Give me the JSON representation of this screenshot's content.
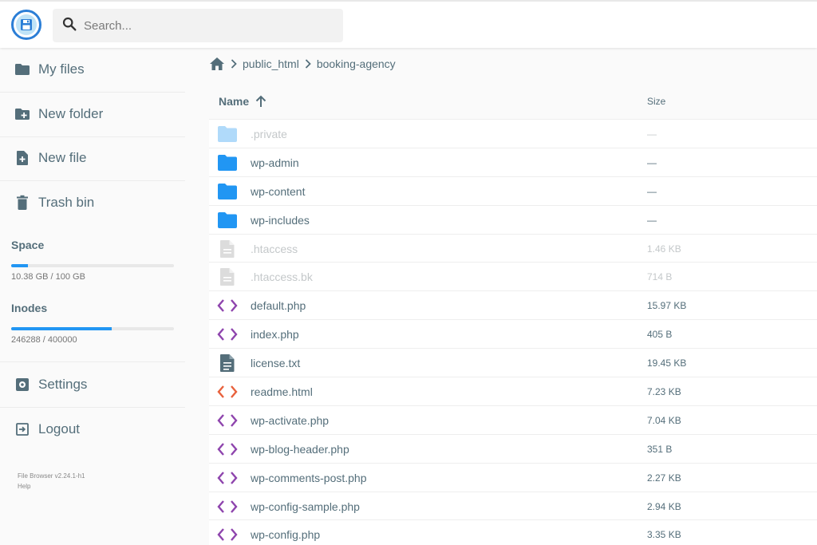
{
  "search": {
    "placeholder": "Search..."
  },
  "sidebar": {
    "my_files": "My files",
    "new_folder": "New folder",
    "new_file": "New file",
    "trash_bin": "Trash bin",
    "settings": "Settings",
    "logout": "Logout"
  },
  "usage": {
    "space": {
      "title": "Space",
      "text": "10.38 GB / 100 GB",
      "fraction": 0.1038
    },
    "inodes": {
      "title": "Inodes",
      "text": "246288 / 400000",
      "fraction": 0.6157
    }
  },
  "footer": {
    "version": "File Browser v2.24.1-h1",
    "help": "Help"
  },
  "breadcrumbs": {
    "items": [
      "public_html",
      "booking-agency"
    ]
  },
  "listing": {
    "name_header": "Name",
    "size_header": "Size",
    "rows": [
      {
        "name": ".private",
        "size": "—",
        "kind": "folder",
        "hidden": true
      },
      {
        "name": "wp-admin",
        "size": "—",
        "kind": "folder",
        "hidden": false
      },
      {
        "name": "wp-content",
        "size": "—",
        "kind": "folder",
        "hidden": false
      },
      {
        "name": "wp-includes",
        "size": "—",
        "kind": "folder",
        "hidden": false
      },
      {
        "name": ".htaccess",
        "size": "1.46 KB",
        "kind": "file",
        "hidden": true
      },
      {
        "name": ".htaccess.bk",
        "size": "714 B",
        "kind": "file",
        "hidden": true
      },
      {
        "name": "default.php",
        "size": "15.97 KB",
        "kind": "code",
        "hidden": false
      },
      {
        "name": "index.php",
        "size": "405 B",
        "kind": "code",
        "hidden": false
      },
      {
        "name": "license.txt",
        "size": "19.45 KB",
        "kind": "text",
        "hidden": false
      },
      {
        "name": "readme.html",
        "size": "7.23 KB",
        "kind": "html",
        "hidden": false
      },
      {
        "name": "wp-activate.php",
        "size": "7.04 KB",
        "kind": "code",
        "hidden": false
      },
      {
        "name": "wp-blog-header.php",
        "size": "351 B",
        "kind": "code",
        "hidden": false
      },
      {
        "name": "wp-comments-post.php",
        "size": "2.27 KB",
        "kind": "code",
        "hidden": false
      },
      {
        "name": "wp-config-sample.php",
        "size": "2.94 KB",
        "kind": "code",
        "hidden": false
      },
      {
        "name": "wp-config.php",
        "size": "3.35 KB",
        "kind": "code",
        "hidden": false
      }
    ]
  },
  "colors": {
    "accent": "#2196f3",
    "folder": "#2196f3",
    "code": "#8e44ad",
    "html": "#e8613c",
    "text": "#546e7a"
  }
}
